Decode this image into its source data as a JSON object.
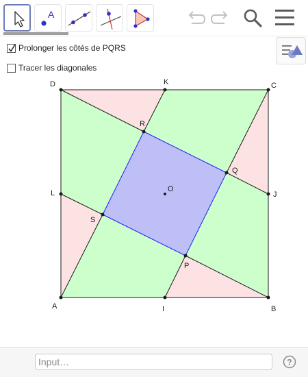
{
  "toolbar": {
    "tools": [
      {
        "icon": "move-tool-icon",
        "active": true
      },
      {
        "icon": "point-tool-icon",
        "label": "A"
      },
      {
        "icon": "line-tool-icon"
      },
      {
        "icon": "perpendicular-tool-icon"
      },
      {
        "icon": "polygon-tool-icon"
      }
    ],
    "controls": [
      "undo-icon",
      "redo-icon",
      "search-icon",
      "menu-icon"
    ]
  },
  "checkboxes": [
    {
      "label": "Prolonger les côtés de PQRS",
      "checked": true
    },
    {
      "label": "Tracer les diagonales",
      "checked": false
    }
  ],
  "geometry": {
    "points": [
      {
        "name": "D"
      },
      {
        "name": "K"
      },
      {
        "name": "C"
      },
      {
        "name": "R"
      },
      {
        "name": "Q"
      },
      {
        "name": "O"
      },
      {
        "name": "L"
      },
      {
        "name": "J"
      },
      {
        "name": "S"
      },
      {
        "name": "P"
      },
      {
        "name": "A"
      },
      {
        "name": "I"
      },
      {
        "name": "B"
      }
    ],
    "colors": {
      "pink_region": "#fde2e4",
      "green_region": "#ccffcc",
      "blue_square": "#bfbff7",
      "blue_edge": "#1a1aff",
      "black_line": "#1a1a1a"
    }
  },
  "input_bar": {
    "placeholder": "Input…"
  }
}
